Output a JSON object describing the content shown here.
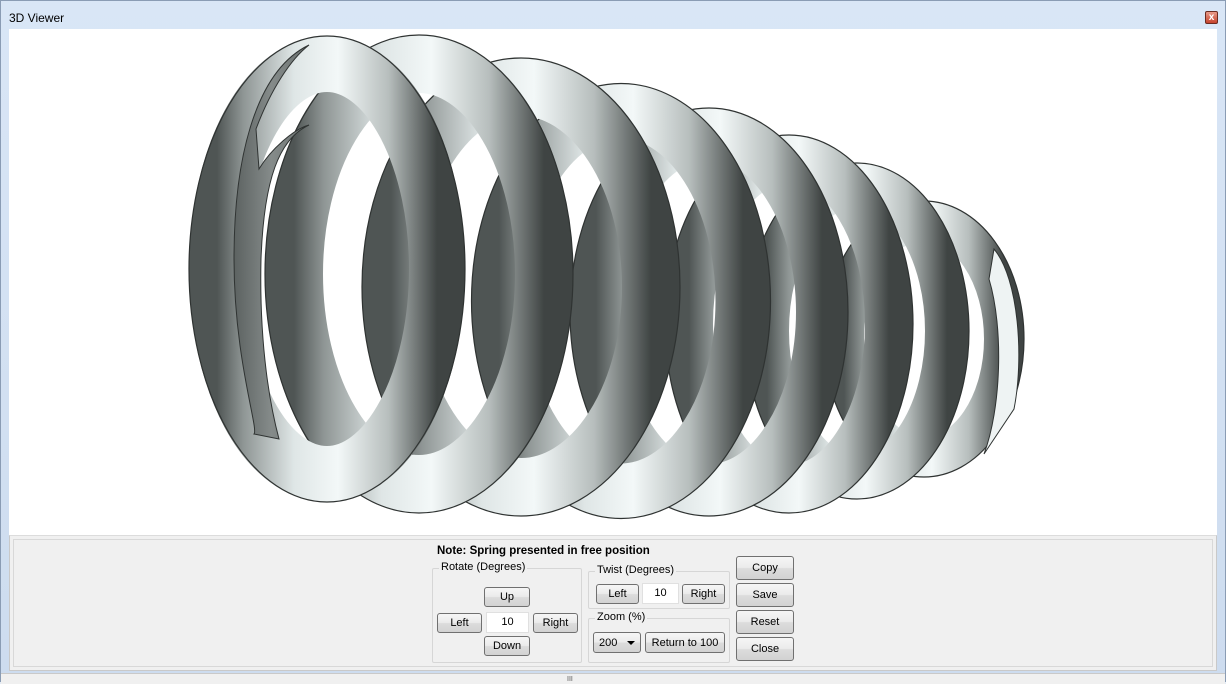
{
  "window": {
    "title": "3D Viewer",
    "close_glyph": "x"
  },
  "controls": {
    "note": "Note: Spring presented in free position",
    "rotate": {
      "label": "Rotate (Degrees)",
      "up": "Up",
      "left": "Left",
      "value": "10",
      "right": "Right",
      "down": "Down"
    },
    "twist": {
      "label": "Twist (Degrees)",
      "left": "Left",
      "value": "10",
      "right": "Right"
    },
    "zoom": {
      "label": "Zoom (%)",
      "selected": "200",
      "return_label": "Return to 100"
    },
    "actions": {
      "copy": "Copy",
      "save": "Save",
      "reset": "Reset",
      "close": "Close"
    }
  },
  "grip_glyph": "III",
  "colors": {
    "spring_light": "#eef4f4",
    "spring_mid": "#c9d0cf",
    "spring_dark": "#5d6362",
    "end_cap": "#7a8080"
  }
}
